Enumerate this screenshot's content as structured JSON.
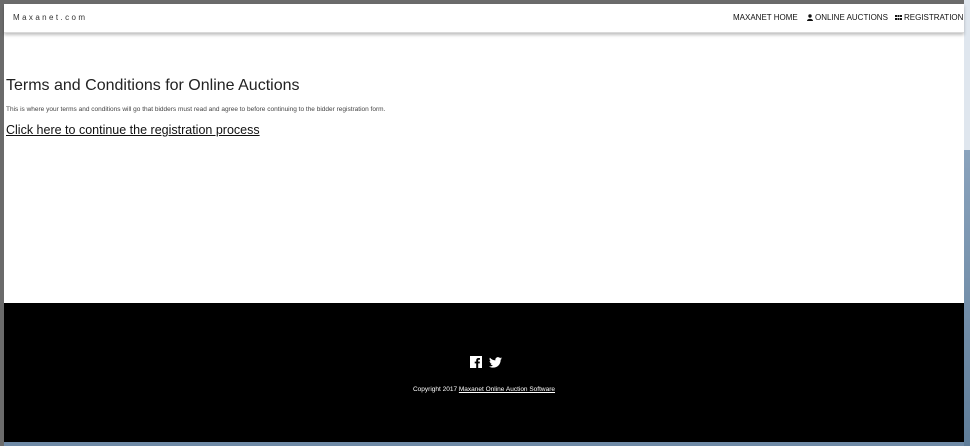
{
  "navbar": {
    "brand": "Maxanet.com",
    "items": [
      {
        "label": "MAXANET HOME",
        "icon": "none"
      },
      {
        "label": "ONLINE AUCTIONS",
        "icon": "user-icon"
      },
      {
        "label": "REGISTRATION",
        "icon": "grid-icon"
      }
    ]
  },
  "main": {
    "title": "Terms and Conditions for Online Auctions",
    "description": "This is where your terms and conditions will go that bidders must read and agree to before continuing to the bidder registration form.",
    "continue_link": "Click here to continue the registration process"
  },
  "footer": {
    "social_icons": [
      "facebook-icon",
      "twitter-icon"
    ],
    "copyright_prefix": "Copyright 2017",
    "copyright_link": "Maxanet Online Auction Software"
  },
  "colors": {
    "footer_bg": "#000000",
    "page_bg": "#ffffff",
    "text": "#222222"
  }
}
